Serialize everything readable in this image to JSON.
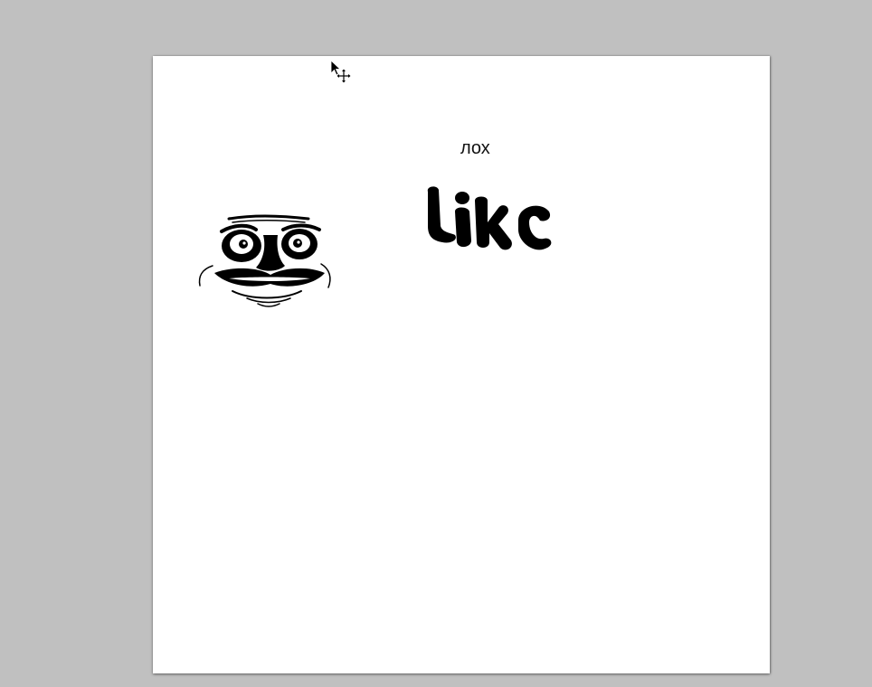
{
  "canvas": {
    "caption": "лох",
    "like_sticker_text": "Like",
    "background": "#ffffff"
  },
  "workspace": {
    "background": "#c0c0c0"
  },
  "cursor": {
    "icon": "move-tool-cursor-icon"
  },
  "images": {
    "meme_face": "me-gusta-face-icon"
  }
}
